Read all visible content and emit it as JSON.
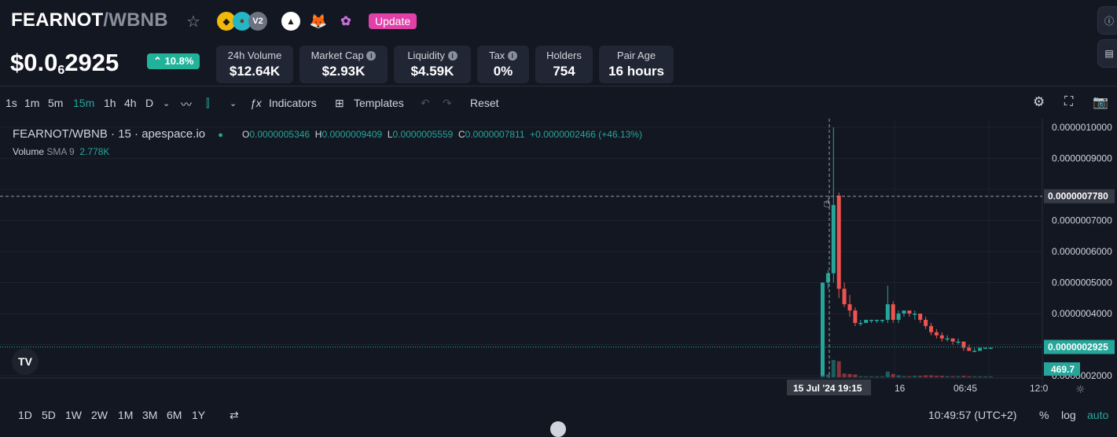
{
  "header": {
    "base": "FEARNOT",
    "quote": "/WBNB",
    "star_icon": "star-icon",
    "badges": [
      {
        "name": "bnb-chain-icon",
        "label": "",
        "color": "#f0b90b"
      },
      {
        "name": "pancakeswap-icon",
        "label": "",
        "color": "#25b6c6"
      },
      {
        "name": "version-badge",
        "label": "V2",
        "color": "#6b7280"
      }
    ],
    "update_label": "Update"
  },
  "price": {
    "prefix": "$0.0",
    "zeros": "6",
    "digits": "2925"
  },
  "change": "10.8%",
  "stats": [
    {
      "label": "24h Volume",
      "value": "$12.64K",
      "info": false
    },
    {
      "label": "Market Cap",
      "value": "$2.93K",
      "info": true
    },
    {
      "label": "Liquidity",
      "value": "$4.59K",
      "info": true
    },
    {
      "label": "Tax",
      "value": "0%",
      "info": true
    },
    {
      "label": "Holders",
      "value": "754",
      "info": false
    },
    {
      "label": "Pair Age",
      "value": "16 hours",
      "info": false
    }
  ],
  "toolbar": {
    "intervals": [
      "1s",
      "1m",
      "5m",
      "15m",
      "1h",
      "4h",
      "D"
    ],
    "active_interval": "15m",
    "indicators": "Indicators",
    "templates": "Templates",
    "reset": "Reset"
  },
  "legend": {
    "symbol": "FEARNOT/WBNB",
    "interval": "15",
    "source": "apespace.io",
    "o_label": "O",
    "o": "0.0000005346",
    "h_label": "H",
    "h": "0.0000009409",
    "l_label": "L",
    "l": "0.0000005559",
    "c_label": "C",
    "c": "0.0000007811",
    "change": "+0.0000002466 (+46.13%)",
    "volume_label": "Volume",
    "volume_sma": "SMA 9",
    "volume_value": "2.778K"
  },
  "price_axis": {
    "ticks": [
      "0.0000010000",
      "0.0000009000",
      "0.0000007000",
      "0.0000006000",
      "0.0000005000",
      "0.0000004000",
      "0.0000002000"
    ],
    "crosshair_label": "0.0000007780",
    "last_price_label": "0.0000002925",
    "volume_label": "469.7"
  },
  "time_axis": {
    "ticks": [
      "16",
      "06:45",
      "12:0"
    ],
    "crosshair_label": "15 Jul '24   19:15"
  },
  "range_buttons": [
    "1D",
    "5D",
    "1W",
    "2W",
    "1M",
    "3M",
    "6M",
    "1Y"
  ],
  "clock": "10:49:57 (UTC+2)",
  "scale_options": {
    "percent": "%",
    "log": "log",
    "auto": "auto"
  },
  "colors": {
    "up": "#26a69a",
    "down": "#ef5350",
    "accent": "#26a69a",
    "update": "#e040a8"
  },
  "chart_data": {
    "type": "candlestick",
    "title": "FEARNOT/WBNB",
    "interval": "15",
    "candles": [
      {
        "o": 1e-08,
        "h": 5e-07,
        "l": 1e-08,
        "c": 5e-07
      },
      {
        "o": 5e-07,
        "h": 5.4e-07,
        "l": 4.8e-07,
        "c": 5.3e-07
      },
      {
        "o": 5.3e-07,
        "h": 1e-06,
        "l": 5e-07,
        "c": 7.5e-07
      },
      {
        "o": 7.8e-07,
        "h": 7.9e-07,
        "l": 4.5e-07,
        "c": 4.8e-07
      },
      {
        "o": 4.8e-07,
        "h": 5e-07,
        "l": 4.2e-07,
        "c": 4.3e-07
      },
      {
        "o": 4.3e-07,
        "h": 4.6e-07,
        "l": 3.9e-07,
        "c": 4.1e-07
      },
      {
        "o": 4.1e-07,
        "h": 4.2e-07,
        "l": 3.6e-07,
        "c": 3.7e-07
      },
      {
        "o": 3.7e-07,
        "h": 3.8e-07,
        "l": 3.6e-07,
        "c": 3.7e-07
      },
      {
        "o": 3.7e-07,
        "h": 3.8e-07,
        "l": 3.7e-07,
        "c": 3.8e-07
      },
      {
        "o": 3.8e-07,
        "h": 3.8e-07,
        "l": 3.7e-07,
        "c": 3.8e-07
      },
      {
        "o": 3.8e-07,
        "h": 3.8e-07,
        "l": 3.7e-07,
        "c": 3.8e-07
      },
      {
        "o": 3.8e-07,
        "h": 3.8e-07,
        "l": 3.7e-07,
        "c": 3.8e-07
      },
      {
        "o": 3.8e-07,
        "h": 4.9e-07,
        "l": 3.7e-07,
        "c": 4.3e-07
      },
      {
        "o": 4.3e-07,
        "h": 4.4e-07,
        "l": 3.7e-07,
        "c": 3.8e-07
      },
      {
        "o": 3.8e-07,
        "h": 4.1e-07,
        "l": 3.7e-07,
        "c": 4e-07
      },
      {
        "o": 4e-07,
        "h": 4.1e-07,
        "l": 3.9e-07,
        "c": 4.1e-07
      },
      {
        "o": 4.1e-07,
        "h": 4.1e-07,
        "l": 3.9e-07,
        "c": 4e-07
      },
      {
        "o": 4e-07,
        "h": 4.1e-07,
        "l": 3.8e-07,
        "c": 4e-07
      },
      {
        "o": 4e-07,
        "h": 4e-07,
        "l": 3.7e-07,
        "c": 3.8e-07
      },
      {
        "o": 3.8e-07,
        "h": 3.9e-07,
        "l": 3.5e-07,
        "c": 3.6e-07
      },
      {
        "o": 3.6e-07,
        "h": 3.7e-07,
        "l": 3.3e-07,
        "c": 3.4e-07
      },
      {
        "o": 3.4e-07,
        "h": 3.5e-07,
        "l": 3.2e-07,
        "c": 3.3e-07
      },
      {
        "o": 3.3e-07,
        "h": 3.4e-07,
        "l": 3.1e-07,
        "c": 3.2e-07
      },
      {
        "o": 3.2e-07,
        "h": 3.3e-07,
        "l": 3.1e-07,
        "c": 3.2e-07
      },
      {
        "o": 3.2e-07,
        "h": 3.2e-07,
        "l": 3e-07,
        "c": 3.1e-07
      },
      {
        "o": 3.1e-07,
        "h": 3.2e-07,
        "l": 3e-07,
        "c": 3.1e-07
      },
      {
        "o": 3.1e-07,
        "h": 3.1e-07,
        "l": 2.8e-07,
        "c": 2.9e-07
      },
      {
        "o": 2.9e-07,
        "h": 3e-07,
        "l": 2.8e-07,
        "c": 2.8e-07
      },
      {
        "o": 2.8e-07,
        "h": 2.9e-07,
        "l": 2.8e-07,
        "c": 2.8e-07
      },
      {
        "o": 2.8e-07,
        "h": 2.9e-07,
        "l": 2.8e-07,
        "c": 2.9e-07
      },
      {
        "o": 2.9e-07,
        "h": 2.9e-07,
        "l": 2.9e-07,
        "c": 2.9e-07
      },
      {
        "o": 2.9e-07,
        "h": 2.9e-07,
        "l": 2.9e-07,
        "c": 2.9e-07
      }
    ]
  }
}
